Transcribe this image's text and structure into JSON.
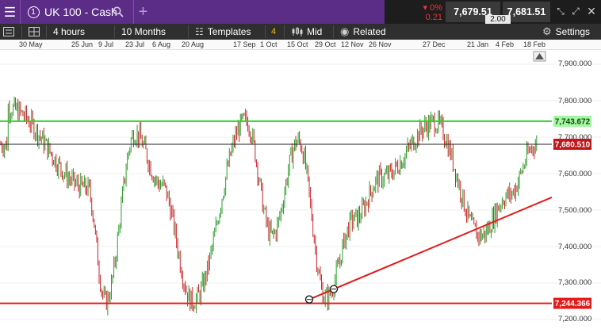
{
  "header": {
    "instrument_number": "1",
    "instrument_name": "UK 100 - Cash",
    "change_pct": "0%",
    "change_abs": "0.21",
    "sell_price": "7,679.51",
    "buy_price": "7,681.51",
    "spread": "2.00"
  },
  "toolbar": {
    "interval": "4 hours",
    "range": "10 Months",
    "templates_label": "Templates",
    "templates_count": "4",
    "price_type": "Mid",
    "related_label": "Related",
    "settings_label": "Settings"
  },
  "date_labels": [
    "30 May",
    "25 Jun",
    "9 Jul",
    "23 Jul",
    "6 Aug",
    "20 Aug",
    "17 Sep",
    "1 Oct",
    "15 Oct",
    "29 Oct",
    "12 Nov",
    "26 Nov",
    "27 Dec",
    "21 Jan",
    "4 Feb",
    "18 Feb"
  ],
  "price_labels": [
    "7,900.000",
    "7,800.000",
    "7,700.000",
    "7,600.000",
    "7,500.000",
    "7,400.000",
    "7,300.000",
    "7,200.000"
  ],
  "colors": {
    "header_bg": "#5b2d86",
    "toolbar_bg": "#2f2f2f",
    "up_candle": "#2e9e2e",
    "down_candle": "#c9262a",
    "resistance_line": "#29d429",
    "support_line": "#e21b1b",
    "current_price_tag": "#c0171c"
  },
  "chart_data": {
    "type": "candlestick",
    "instrument": "UK 100 - Cash",
    "timeframe": "4 hours",
    "range": "10 Months",
    "x_ticks": [
      "30 May",
      "25 Jun",
      "9 Jul",
      "23 Jul",
      "6 Aug",
      "20 Aug",
      "17 Sep",
      "1 Oct",
      "15 Oct",
      "29 Oct",
      "12 Nov",
      "26 Nov",
      "27 Dec",
      "21 Jan",
      "4 Feb",
      "18 Feb"
    ],
    "y_ticks": [
      7900,
      7800,
      7700,
      7600,
      7500,
      7400,
      7300,
      7200
    ],
    "ylim": [
      7180,
      7950
    ],
    "current_price": 7680.51,
    "current_price_label": "7,680.510",
    "horizontal_lines": [
      {
        "value": 7743.672,
        "label": "7,743.672",
        "color": "#29d429"
      },
      {
        "value": 7680.51,
        "label": "",
        "color": "#222222"
      },
      {
        "value": 7244.366,
        "label": "7,244.366",
        "color": "#e21b1b"
      }
    ],
    "trendline": {
      "start": {
        "date": "29 Oct",
        "value": 7255
      },
      "end": {
        "date": "18 Feb",
        "value": 7535
      },
      "color": "#e21b1b"
    },
    "series_approx": [
      {
        "date": "30 May",
        "value": 7780
      },
      {
        "date": "25 Jun",
        "value": 7560
      },
      {
        "date": "9 Jul",
        "value": 7250
      },
      {
        "date": "23 Jul",
        "value": 7710
      },
      {
        "date": "6 Aug",
        "value": 7570
      },
      {
        "date": "20 Aug",
        "value": 7250
      },
      {
        "date": "17 Sep",
        "value": 7745
      },
      {
        "date": "1 Oct",
        "value": 7430
      },
      {
        "date": "15 Oct",
        "value": 7690
      },
      {
        "date": "29 Oct",
        "value": 7260
      },
      {
        "date": "12 Nov",
        "value": 7475
      },
      {
        "date": "26 Nov",
        "value": 7590
      },
      {
        "date": "27 Dec",
        "value": 7740
      },
      {
        "date": "21 Jan",
        "value": 7430
      },
      {
        "date": "4 Feb",
        "value": 7540
      },
      {
        "date": "18 Feb",
        "value": 7680
      }
    ]
  }
}
